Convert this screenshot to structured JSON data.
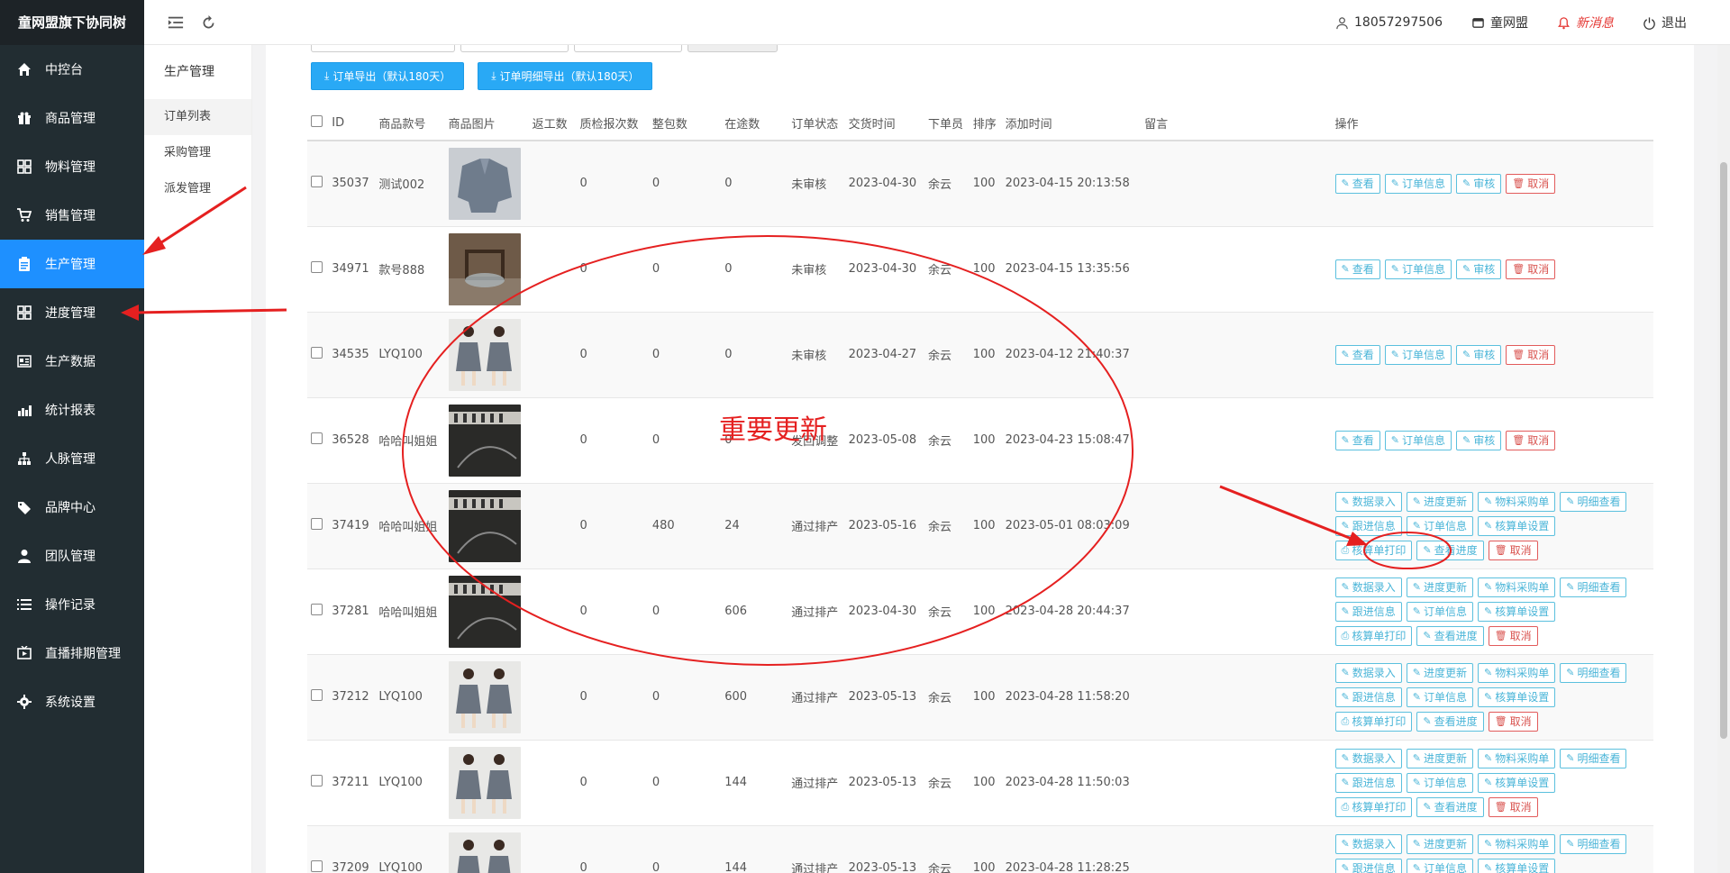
{
  "brand": "童网盟旗下协同树",
  "sidebar": {
    "items": [
      {
        "label": "中控台",
        "icon": "home-icon"
      },
      {
        "label": "商品管理",
        "icon": "gift-icon"
      },
      {
        "label": "物料管理",
        "icon": "grid-icon"
      },
      {
        "label": "销售管理",
        "icon": "cart-icon"
      },
      {
        "label": "生产管理",
        "icon": "clipboard-icon",
        "active": true
      },
      {
        "label": "进度管理",
        "icon": "grid-icon"
      },
      {
        "label": "生产数据",
        "icon": "image-icon"
      },
      {
        "label": "统计报表",
        "icon": "chart-icon"
      },
      {
        "label": "人脉管理",
        "icon": "sitemap-icon"
      },
      {
        "label": "品牌中心",
        "icon": "tags-icon"
      },
      {
        "label": "团队管理",
        "icon": "user-icon"
      },
      {
        "label": "操作记录",
        "icon": "list-icon"
      },
      {
        "label": "直播排期管理",
        "icon": "tv-icon"
      },
      {
        "label": "系统设置",
        "icon": "gear-icon"
      }
    ]
  },
  "header": {
    "phone": "18057297506",
    "shop": "童网盟",
    "new_message": "新消息",
    "logout": "退出"
  },
  "submenu": {
    "title": "生产管理",
    "items": [
      "订单列表",
      "采购管理",
      "派发管理"
    ]
  },
  "toolbar": {
    "export_orders": "订单导出（默认180天）",
    "export_details": "订单明细导出（默认180天）"
  },
  "table": {
    "columns": [
      "ID",
      "商品款号",
      "商品图片",
      "返工数",
      "质检报次数",
      "整包数",
      "在途数",
      "订单状态",
      "交货时间",
      "下单员",
      "排序",
      "添加时间",
      "留言",
      "操作"
    ],
    "rows": [
      {
        "id": "35037",
        "sku": "测试002",
        "rework": "",
        "qc": "0",
        "pack": "0",
        "transit": "0",
        "status": "未审核",
        "delivery": "2023-04-30",
        "clerk": "余云",
        "sort": "100",
        "added": "2023-04-15 20:13:58",
        "note": "",
        "ops": "basic",
        "img": "denim"
      },
      {
        "id": "34971",
        "sku": "款号888",
        "rework": "",
        "qc": "0",
        "pack": "0",
        "transit": "0",
        "status": "未审核",
        "delivery": "2023-04-30",
        "clerk": "余云",
        "sort": "100",
        "added": "2023-04-15 13:35:56",
        "note": "",
        "ops": "basic",
        "img": "room"
      },
      {
        "id": "34535",
        "sku": "LYQ100",
        "rework": "",
        "qc": "0",
        "pack": "0",
        "transit": "0",
        "status": "未审核",
        "delivery": "2023-04-27",
        "clerk": "余云",
        "sort": "100",
        "added": "2023-04-12 21:40:37",
        "note": "",
        "ops": "basic",
        "img": "girl"
      },
      {
        "id": "36528",
        "sku": "哈哈叫姐姐",
        "rework": "",
        "qc": "0",
        "pack": "0",
        "transit": "0",
        "status": "发回调整",
        "delivery": "2023-05-08",
        "clerk": "余云",
        "sort": "100",
        "added": "2023-04-23 15:08:47",
        "note": "",
        "ops": "basic",
        "img": "dark"
      },
      {
        "id": "37419",
        "sku": "哈哈叫姐姐",
        "rework": "",
        "qc": "0",
        "pack": "480",
        "transit": "24",
        "status": "通过排产",
        "delivery": "2023-05-16",
        "clerk": "余云",
        "sort": "100",
        "added": "2023-05-01 08:03:09",
        "note": "",
        "ops": "full",
        "img": "dark"
      },
      {
        "id": "37281",
        "sku": "哈哈叫姐姐",
        "rework": "",
        "qc": "0",
        "pack": "0",
        "transit": "606",
        "status": "通过排产",
        "delivery": "2023-04-30",
        "clerk": "余云",
        "sort": "100",
        "added": "2023-04-28 20:44:37",
        "note": "",
        "ops": "full",
        "img": "dark"
      },
      {
        "id": "37212",
        "sku": "LYQ100",
        "rework": "",
        "qc": "0",
        "pack": "0",
        "transit": "600",
        "status": "通过排产",
        "delivery": "2023-05-13",
        "clerk": "余云",
        "sort": "100",
        "added": "2023-04-28 11:58:20",
        "note": "",
        "ops": "full",
        "img": "girl"
      },
      {
        "id": "37211",
        "sku": "LYQ100",
        "rework": "",
        "qc": "0",
        "pack": "0",
        "transit": "144",
        "status": "通过排产",
        "delivery": "2023-05-13",
        "clerk": "余云",
        "sort": "100",
        "added": "2023-04-28 11:50:03",
        "note": "",
        "ops": "full",
        "img": "girl"
      },
      {
        "id": "37209",
        "sku": "LYQ100",
        "rework": "",
        "qc": "0",
        "pack": "0",
        "transit": "144",
        "status": "通过排产",
        "delivery": "2023-05-13",
        "clerk": "余云",
        "sort": "100",
        "added": "2023-04-28 11:28:25",
        "note": "",
        "ops": "full",
        "img": "girl"
      }
    ],
    "ops_basic": [
      {
        "label": "查看",
        "icon": "pencil-icon"
      },
      {
        "label": "订单信息",
        "icon": "pencil-icon"
      },
      {
        "label": "审核",
        "icon": "pencil-icon"
      },
      {
        "label": "取消",
        "icon": "trash-icon",
        "danger": true
      }
    ],
    "ops_full": [
      {
        "label": "数据录入",
        "icon": "pencil-icon"
      },
      {
        "label": "进度更新",
        "icon": "pencil-icon"
      },
      {
        "label": "物料采购单",
        "icon": "pencil-icon"
      },
      {
        "label": "明细查看",
        "icon": "pencil-icon"
      },
      {
        "label": "跟进信息",
        "icon": "pencil-icon"
      },
      {
        "label": "订单信息",
        "icon": "pencil-icon"
      },
      {
        "label": "核算单设置",
        "icon": "pencil-icon"
      },
      {
        "label": "核算单打印",
        "icon": "print-icon"
      },
      {
        "label": "查看进度",
        "icon": "pencil-icon"
      },
      {
        "label": "取消",
        "icon": "trash-icon",
        "danger": true
      }
    ]
  },
  "annotation": {
    "text": "重要更新",
    "color": "#e52020"
  },
  "colors": {
    "sidebar_bg": "#222d32",
    "active": "#1e90ff",
    "export_btn": "#29a9f5",
    "link": "#1e3fcc",
    "op_border": "#5bc0de",
    "danger": "#d9534f"
  }
}
